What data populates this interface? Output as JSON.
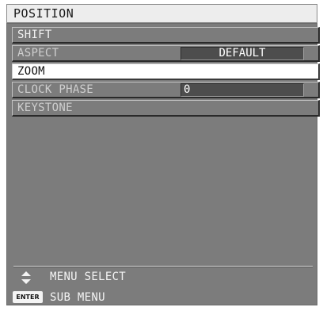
{
  "title": "POSITION",
  "menu": [
    {
      "label": "SHIFT",
      "value": null
    },
    {
      "label": "ASPECT",
      "value": "DEFAULT"
    },
    {
      "label": "ZOOM",
      "value": null,
      "selected": true
    },
    {
      "label": "CLOCK PHASE",
      "value": "0"
    },
    {
      "label": "KEYSTONE",
      "value": null
    }
  ],
  "footer": {
    "menu_select": "MENU SELECT",
    "enter_label": "ENTER",
    "sub_menu": "SUB MENU"
  },
  "icons": {
    "select": "up-down-arrow-icon",
    "enter": "enter-key-icon"
  },
  "colors": {
    "panel": "#7c7c7c",
    "selected": "#ffffff",
    "value_box": "#4d4d4d"
  }
}
